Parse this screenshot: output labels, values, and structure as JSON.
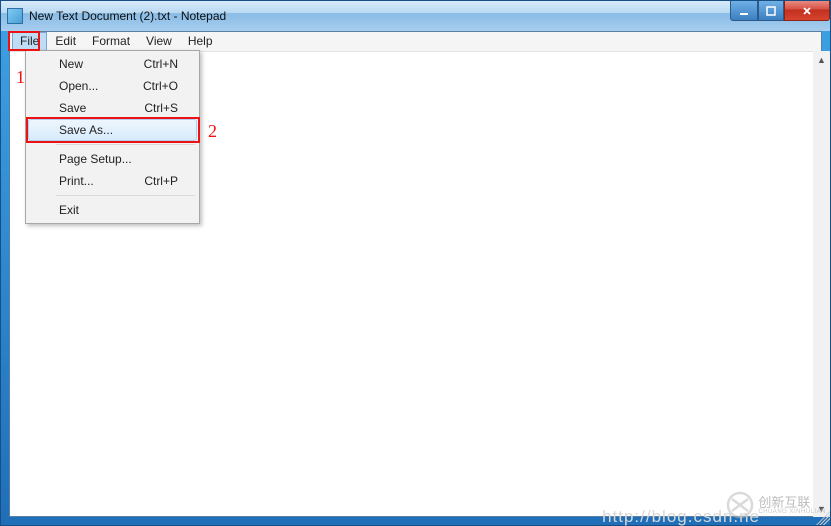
{
  "window": {
    "title": "New Text Document (2).txt - Notepad"
  },
  "menubar": {
    "items": [
      "File",
      "Edit",
      "Format",
      "View",
      "Help"
    ],
    "active_index": 0
  },
  "file_menu": {
    "items": [
      {
        "label": "New",
        "shortcut": "Ctrl+N"
      },
      {
        "label": "Open...",
        "shortcut": "Ctrl+O"
      },
      {
        "label": "Save",
        "shortcut": "Ctrl+S"
      },
      {
        "label": "Save As...",
        "shortcut": ""
      },
      {
        "label": "Page Setup...",
        "shortcut": ""
      },
      {
        "label": "Print...",
        "shortcut": "Ctrl+P"
      },
      {
        "label": "Exit",
        "shortcut": ""
      }
    ],
    "hover_index": 3
  },
  "annotations": {
    "n1": "1",
    "n2": "2",
    "box1_target": "File menu button",
    "box2_target": "Save As... menu item"
  },
  "watermark": {
    "url": "http://blog.csdn.ne",
    "logo_text": "创新互联",
    "logo_sub": "CHUANG XINHULIAN"
  }
}
